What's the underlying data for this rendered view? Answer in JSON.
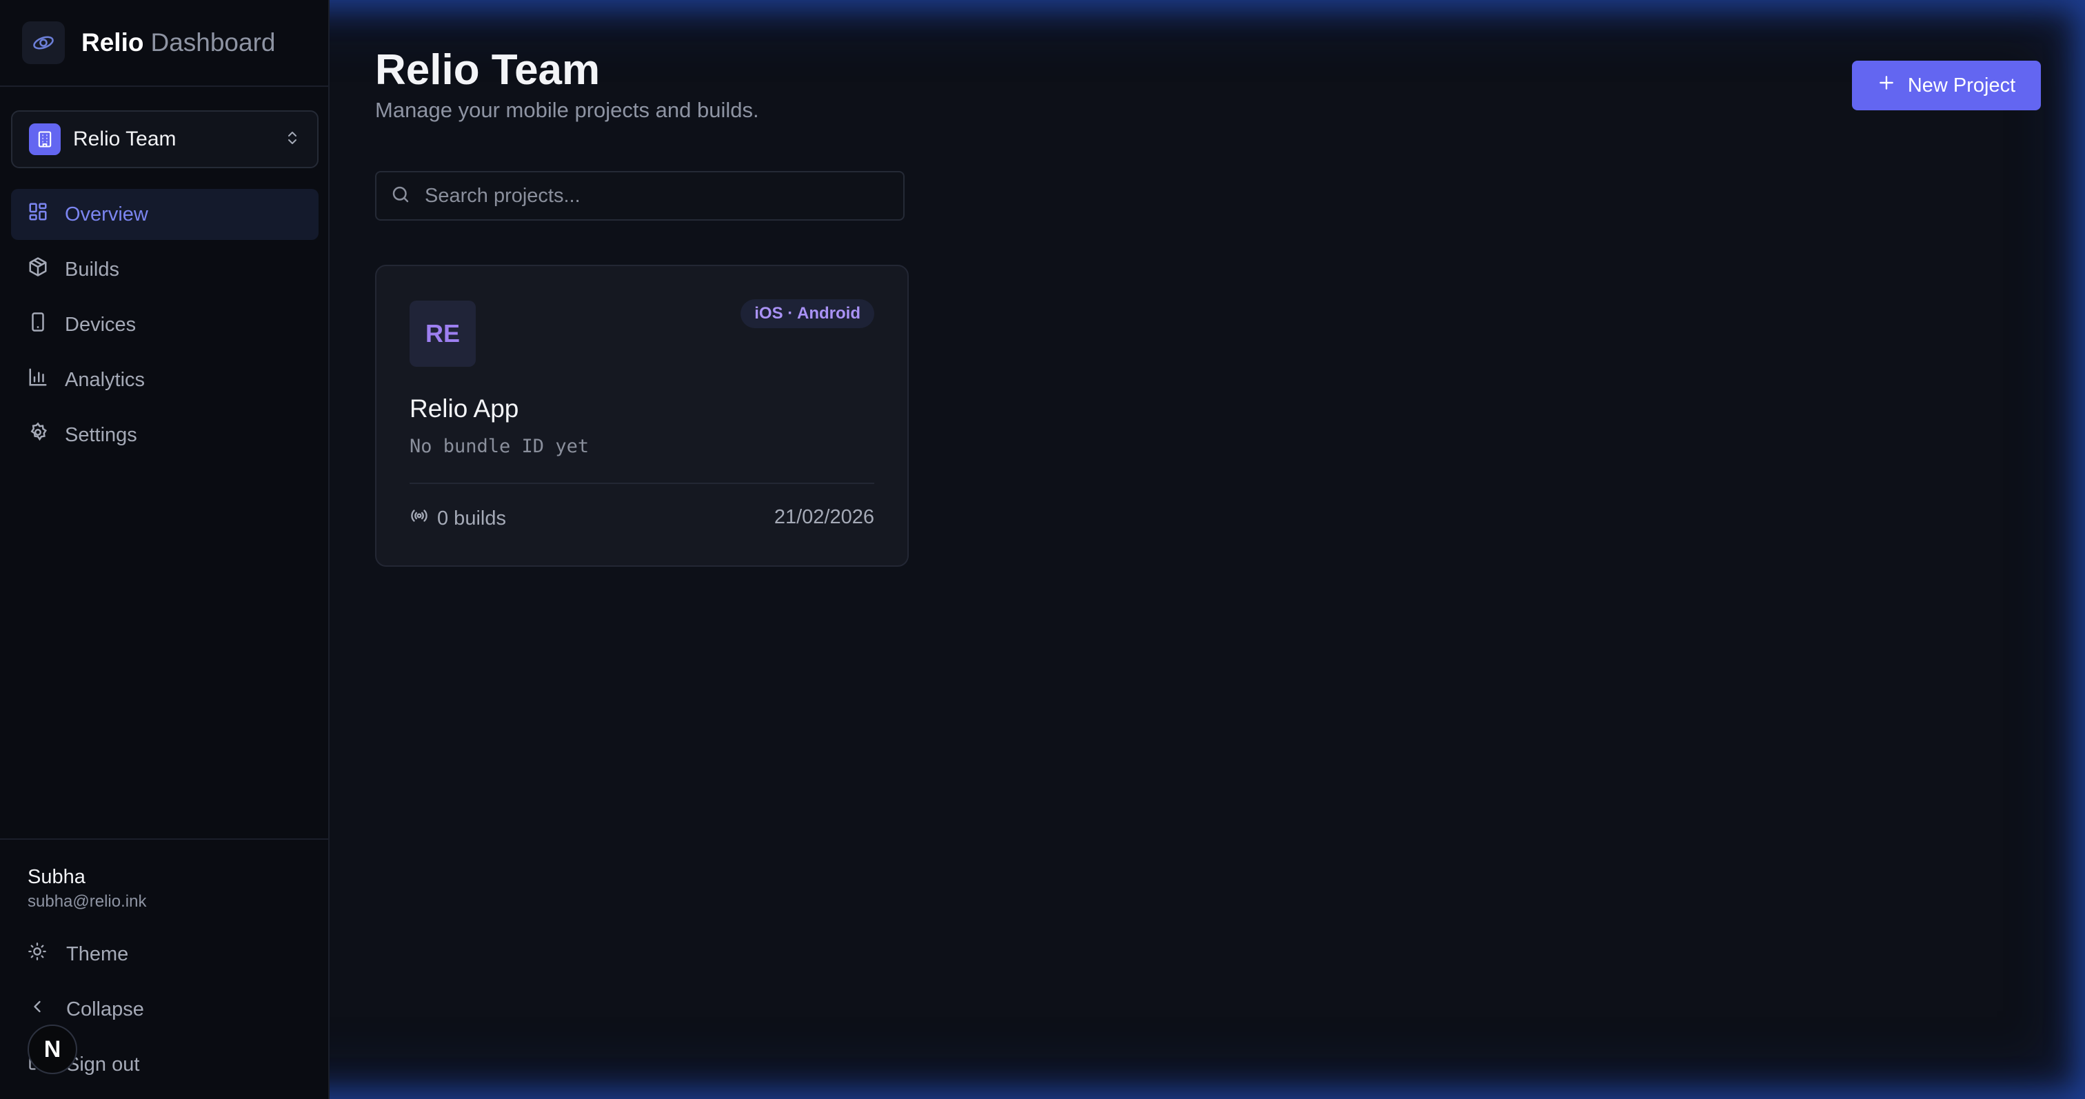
{
  "brand": {
    "name": "Relio",
    "sub": "Dashboard"
  },
  "team": {
    "name": "Relio Team"
  },
  "nav": {
    "items": [
      {
        "label": "Overview",
        "icon": "layout-grid-icon",
        "active": true
      },
      {
        "label": "Builds",
        "icon": "package-icon",
        "active": false
      },
      {
        "label": "Devices",
        "icon": "smartphone-icon",
        "active": false
      },
      {
        "label": "Analytics",
        "icon": "bar-chart-icon",
        "active": false
      },
      {
        "label": "Settings",
        "icon": "gear-icon",
        "active": false
      }
    ]
  },
  "user": {
    "name": "Subha",
    "email": "subha@relio.ink"
  },
  "footer": {
    "theme_label": "Theme",
    "collapse_label": "Collapse",
    "signout_label": "Sign out",
    "dev_badge": "N"
  },
  "header": {
    "title": "Relio Team",
    "subtitle": "Manage your mobile projects and builds.",
    "new_project_label": "New Project"
  },
  "search": {
    "placeholder": "Search projects...",
    "value": ""
  },
  "projects": [
    {
      "initials": "RE",
      "platforms": "iOS · Android",
      "name": "Relio App",
      "bundle": "No bundle ID yet",
      "builds": "0 builds",
      "date": "21/02/2026"
    }
  ],
  "colors": {
    "accent": "#6366f1",
    "background": "#0d1018",
    "glow": "#2a5ad2"
  }
}
